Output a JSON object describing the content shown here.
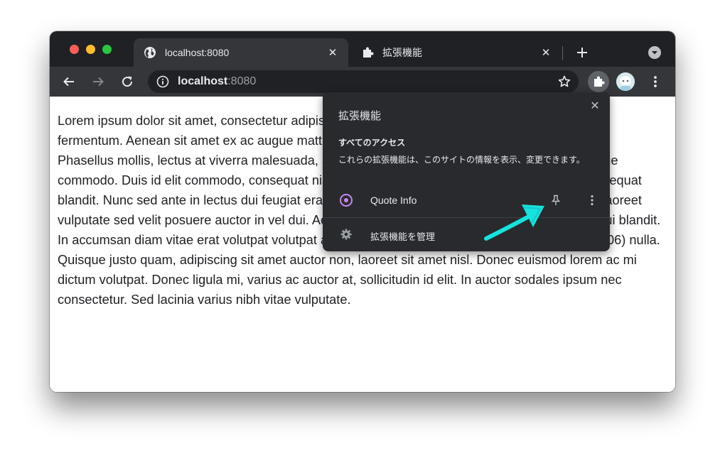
{
  "tabs": [
    {
      "title": "localhost:8080",
      "icon": "globe-icon",
      "active": true
    },
    {
      "title": "拡張機能",
      "icon": "puzzle-icon",
      "active": false
    }
  ],
  "toolbar": {
    "url_host": "localhost",
    "url_port": ":8080"
  },
  "content": {
    "text": "Lorem ipsum dolor sit amet, consectetur adipiscing elit. Pellentesque non velit interdum (1301) fermentum. Aenean sit amet ex ac augue mattis auctor nec et eros venenatis lectus semper vel. Phasellus mollis, lectus at viverra malesuada, augue sed. Cras tristique augue eget libero tristique commodo. Duis id elit commodo, consequat nisl et, feugiat rutrum. Duis placerat lorem quis consequat blandit. Nunc sed ante in lectus dui feugiat erat condimentum rutrum. Sed eget turpis non risus laoreet vulputate sed velit posuere auctor in vel dui. Aenean congue, elit vitae dapibus commodo, orci dui blandit. In accumsan diam vitae erat volutpat volutpat aliquam nunc euismod. Vivamus viverra lorem (8306) nulla. Quisque justo quam, adipiscing sit amet auctor non, laoreet sit amet nisl. Donec euismod lorem ac mi dictum volutpat. Donec ligula mi, varius ac auctor at, sollicitudin id elit. In auctor sodales ipsum nec consectetur. Sed lacinia varius nibh vitae vulputate."
  },
  "popup": {
    "title": "拡張機能",
    "section_title": "すべてのアクセス",
    "description": "これらの拡張機能は、このサイトの情報を表示、変更できます。",
    "extension_name": "Quote Info",
    "manage_label": "拡張機能を管理"
  },
  "colors": {
    "tabstrip": "#202124",
    "toolbar": "#35363a",
    "popup_bg": "#292a2d",
    "extension_icon": "#c586f4",
    "annotation_arrow": "#16e3e0"
  }
}
